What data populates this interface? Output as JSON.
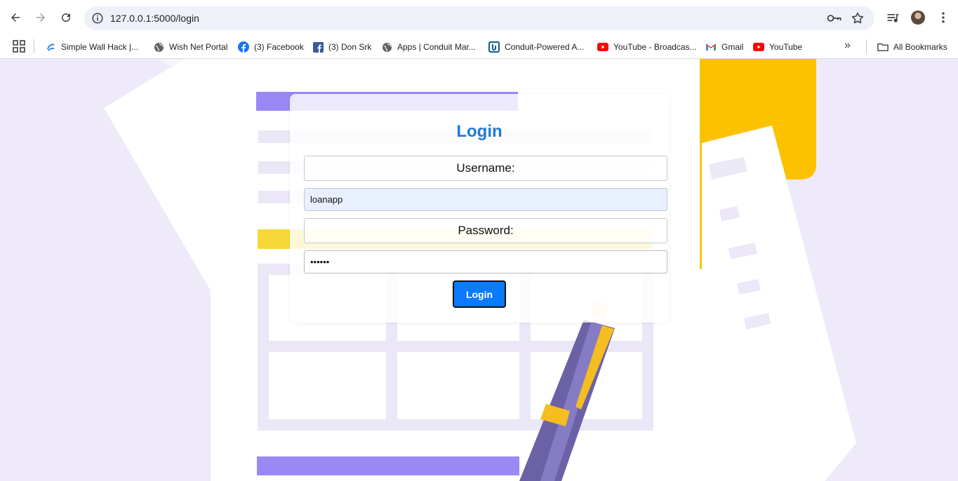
{
  "browser": {
    "url": "127.0.0.1:5000/login",
    "bookmarks": [
      {
        "label": "Simple Wall Hack |...",
        "icon": "link-icon"
      },
      {
        "label": "Wish Net Portal",
        "icon": "globe-icon"
      },
      {
        "label": "(3) Facebook",
        "icon": "facebook-icon"
      },
      {
        "label": "(3) Don Srk",
        "icon": "facebook-square-icon"
      },
      {
        "label": "Apps | Conduit Mar...",
        "icon": "globe-icon"
      },
      {
        "label": "Conduit-Powered A...",
        "icon": "conduit-icon"
      },
      {
        "label": "YouTube - Broadcas...",
        "icon": "youtube-icon"
      },
      {
        "label": "Gmail",
        "icon": "gmail-icon"
      },
      {
        "label": "YouTube",
        "icon": "youtube-icon"
      }
    ],
    "all_bookmarks_label": "All Bookmarks",
    "more_label": "»"
  },
  "login": {
    "title": "Login",
    "username_label": "Username:",
    "username_value": "loanapp",
    "password_label": "Password:",
    "password_value": "••••••",
    "button_label": "Login"
  },
  "colors": {
    "accent": "#0a7bff",
    "title": "#1f7ad9",
    "background": "#eeeaf9"
  }
}
